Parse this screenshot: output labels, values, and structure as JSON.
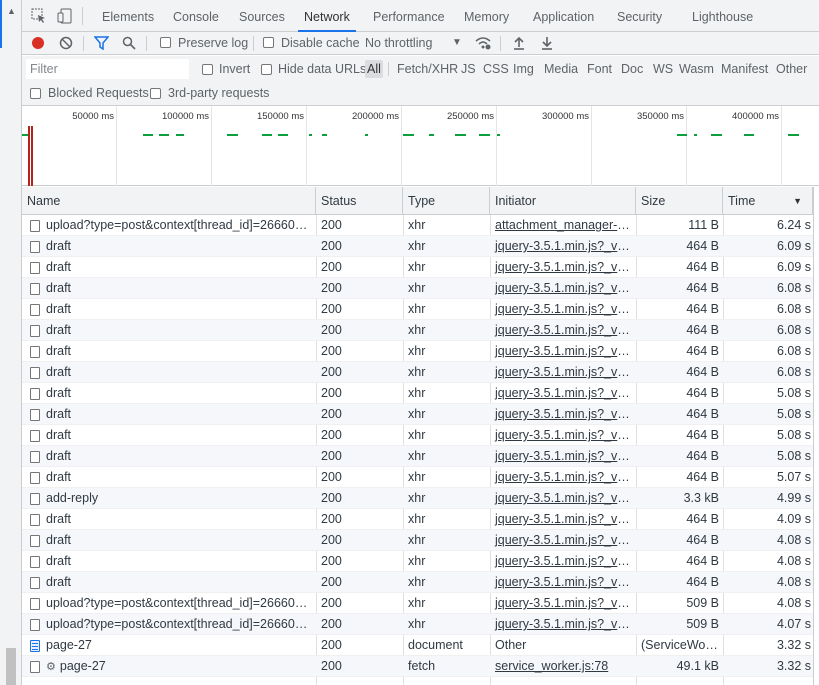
{
  "tabs": [
    "Elements",
    "Console",
    "Sources",
    "Network",
    "Performance",
    "Memory",
    "Application",
    "Security",
    "Lighthouse"
  ],
  "active_tab": "Network",
  "toolbar": {
    "preserve_log": "Preserve log",
    "disable_cache": "Disable cache",
    "throttling": "No throttling"
  },
  "filter": {
    "placeholder": "Filter",
    "invert": "Invert",
    "hide_data_urls": "Hide data URLs",
    "types": [
      "All",
      "Fetch/XHR",
      "JS",
      "CSS",
      "Img",
      "Media",
      "Font",
      "Doc",
      "WS",
      "Wasm",
      "Manifest",
      "Other"
    ],
    "active_type": "All",
    "blocked_requests": "Blocked Requests",
    "third_party": "3rd-party requests"
  },
  "overview": {
    "ticks": [
      "50000 ms",
      "100000 ms",
      "150000 ms",
      "200000 ms",
      "250000 ms",
      "300000 ms",
      "350000 ms",
      "400000 ms"
    ]
  },
  "columns": [
    "Name",
    "Status",
    "Type",
    "Initiator",
    "Size",
    "Time"
  ],
  "rows": [
    {
      "name": "upload?type=post&context[thread_id]=266602...",
      "status": "200",
      "type": "xhr",
      "initiator": "attachment_manager-c...",
      "size": "111 B",
      "time": "6.24 s",
      "icon": "checkbox"
    },
    {
      "name": "draft",
      "status": "200",
      "type": "xhr",
      "initiator": "jquery-3.5.1.min.js?_v=3...",
      "size": "464 B",
      "time": "6.09 s",
      "icon": "checkbox"
    },
    {
      "name": "draft",
      "status": "200",
      "type": "xhr",
      "initiator": "jquery-3.5.1.min.js?_v=3...",
      "size": "464 B",
      "time": "6.09 s",
      "icon": "checkbox"
    },
    {
      "name": "draft",
      "status": "200",
      "type": "xhr",
      "initiator": "jquery-3.5.1.min.js?_v=3...",
      "size": "464 B",
      "time": "6.08 s",
      "icon": "checkbox"
    },
    {
      "name": "draft",
      "status": "200",
      "type": "xhr",
      "initiator": "jquery-3.5.1.min.js?_v=3...",
      "size": "464 B",
      "time": "6.08 s",
      "icon": "checkbox"
    },
    {
      "name": "draft",
      "status": "200",
      "type": "xhr",
      "initiator": "jquery-3.5.1.min.js?_v=3...",
      "size": "464 B",
      "time": "6.08 s",
      "icon": "checkbox"
    },
    {
      "name": "draft",
      "status": "200",
      "type": "xhr",
      "initiator": "jquery-3.5.1.min.js?_v=3...",
      "size": "464 B",
      "time": "6.08 s",
      "icon": "checkbox"
    },
    {
      "name": "draft",
      "status": "200",
      "type": "xhr",
      "initiator": "jquery-3.5.1.min.js?_v=3...",
      "size": "464 B",
      "time": "6.08 s",
      "icon": "checkbox"
    },
    {
      "name": "draft",
      "status": "200",
      "type": "xhr",
      "initiator": "jquery-3.5.1.min.js?_v=3...",
      "size": "464 B",
      "time": "5.08 s",
      "icon": "checkbox"
    },
    {
      "name": "draft",
      "status": "200",
      "type": "xhr",
      "initiator": "jquery-3.5.1.min.js?_v=3...",
      "size": "464 B",
      "time": "5.08 s",
      "icon": "checkbox"
    },
    {
      "name": "draft",
      "status": "200",
      "type": "xhr",
      "initiator": "jquery-3.5.1.min.js?_v=3...",
      "size": "464 B",
      "time": "5.08 s",
      "icon": "checkbox"
    },
    {
      "name": "draft",
      "status": "200",
      "type": "xhr",
      "initiator": "jquery-3.5.1.min.js?_v=3...",
      "size": "464 B",
      "time": "5.08 s",
      "icon": "checkbox"
    },
    {
      "name": "draft",
      "status": "200",
      "type": "xhr",
      "initiator": "jquery-3.5.1.min.js?_v=3...",
      "size": "464 B",
      "time": "5.07 s",
      "icon": "checkbox"
    },
    {
      "name": "add-reply",
      "status": "200",
      "type": "xhr",
      "initiator": "jquery-3.5.1.min.js?_v=3...",
      "size": "3.3 kB",
      "time": "4.99 s",
      "icon": "checkbox"
    },
    {
      "name": "draft",
      "status": "200",
      "type": "xhr",
      "initiator": "jquery-3.5.1.min.js?_v=3...",
      "size": "464 B",
      "time": "4.09 s",
      "icon": "checkbox"
    },
    {
      "name": "draft",
      "status": "200",
      "type": "xhr",
      "initiator": "jquery-3.5.1.min.js?_v=3...",
      "size": "464 B",
      "time": "4.08 s",
      "icon": "checkbox"
    },
    {
      "name": "draft",
      "status": "200",
      "type": "xhr",
      "initiator": "jquery-3.5.1.min.js?_v=3...",
      "size": "464 B",
      "time": "4.08 s",
      "icon": "checkbox"
    },
    {
      "name": "draft",
      "status": "200",
      "type": "xhr",
      "initiator": "jquery-3.5.1.min.js?_v=3...",
      "size": "464 B",
      "time": "4.08 s",
      "icon": "checkbox"
    },
    {
      "name": "upload?type=post&context[thread_id]=266602...",
      "status": "200",
      "type": "xhr",
      "initiator": "jquery-3.5.1.min.js?_v=3...",
      "size": "509 B",
      "time": "4.08 s",
      "icon": "checkbox"
    },
    {
      "name": "upload?type=post&context[thread_id]=266602...",
      "status": "200",
      "type": "xhr",
      "initiator": "jquery-3.5.1.min.js?_v=3...",
      "size": "509 B",
      "time": "4.07 s",
      "icon": "checkbox"
    },
    {
      "name": "page-27",
      "status": "200",
      "type": "document",
      "initiator": "Other",
      "size": "(ServiceWork...",
      "time": "3.32 s",
      "icon": "document"
    },
    {
      "name": "page-27",
      "status": "200",
      "type": "fetch",
      "initiator": "service_worker.js:78",
      "size": "49.1 kB",
      "time": "3.32 s",
      "icon": "gear"
    }
  ]
}
